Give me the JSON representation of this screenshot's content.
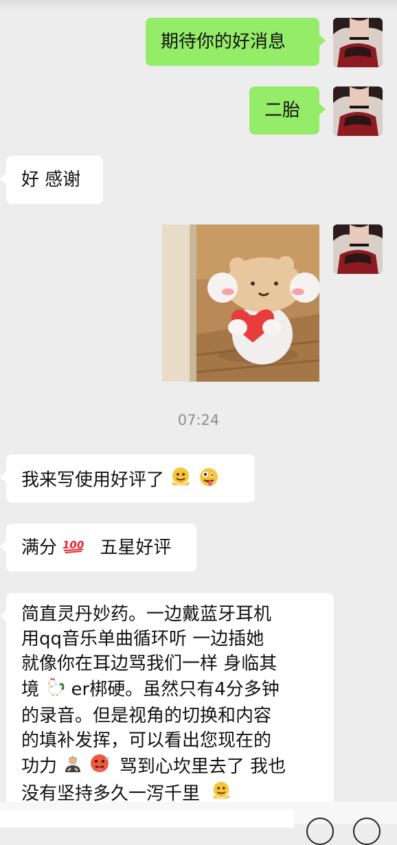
{
  "messages": {
    "m1": "期待你的好消息",
    "m2": "二胎",
    "m3": "好 感谢",
    "time": "07:24",
    "m4": "我来写使用好评了",
    "m5_a": "满分",
    "m5_b": "五星好评",
    "m6": {
      "l1": "简直灵丹妙药。一边戴蓝牙耳机",
      "l2": "用qq音乐单曲循环听 一边插她",
      "l3": "就像你在耳边骂我们一样 身临其",
      "l4_a": "境",
      "l4_b": "er梆硬。虽然只有4分多钟",
      "l5": "的录音。但是视角的切换和内容",
      "l6": "的填补发挥，可以看出您现在的",
      "l7_a": "功力",
      "l7_b": "骂到心坎里去了 我也",
      "l8": "没有坚持多久一泻千里"
    }
  },
  "colors": {
    "background": "#ededed",
    "my_bubble": "#95ec69",
    "other_bubble": "#ffffff",
    "timestamp": "#8e8e8e"
  },
  "icons": {
    "m4_emojis": [
      "melting-face-icon",
      "zany-face-icon"
    ],
    "m5_emoji": "hundred-points-icon",
    "m6_emojis": [
      "rooster-icon",
      "person-bowing-icon",
      "hot-face-icon",
      "melting-face-icon"
    ]
  }
}
